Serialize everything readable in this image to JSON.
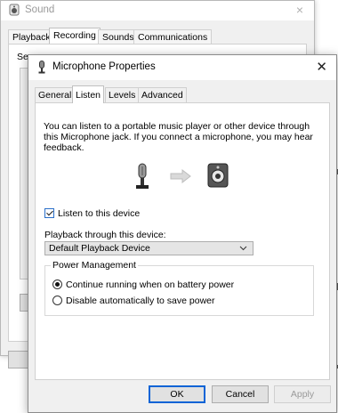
{
  "sound_window": {
    "title": "Sound",
    "close_glyph": "×",
    "tabs": [
      {
        "label": "Playback"
      },
      {
        "label": "Recording"
      },
      {
        "label": "Sounds"
      },
      {
        "label": "Communications"
      }
    ],
    "partial_text": "Se"
  },
  "dialog": {
    "title": "Microphone Properties",
    "close_glyph": "✕",
    "tabs": [
      {
        "label": "General"
      },
      {
        "label": "Listen"
      },
      {
        "label": "Levels"
      },
      {
        "label": "Advanced"
      }
    ],
    "description": "You can listen to a portable music player or other device through this Microphone jack.  If you connect a microphone, you may hear feedback.",
    "listen_checkbox_label": "Listen to this device",
    "playback_label": "Playback through this device:",
    "playback_value": "Default Playback Device",
    "power_management": {
      "legend": "Power Management",
      "options": [
        {
          "label": "Continue running when on battery power"
        },
        {
          "label": "Disable automatically to save power"
        }
      ]
    },
    "buttons": {
      "ok": "OK",
      "cancel": "Cancel",
      "apply": "Apply"
    }
  },
  "icons": {
    "title_icon": "microphone-icon",
    "sound_icon": "speaker-icon",
    "illustration": [
      "microphone-icon",
      "arrow-right-icon",
      "speaker-icon"
    ]
  }
}
